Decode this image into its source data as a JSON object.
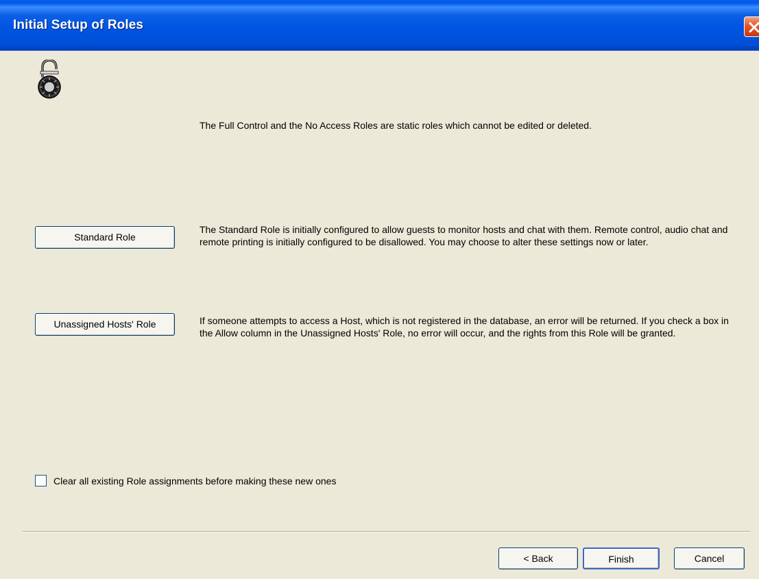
{
  "window": {
    "title": "Initial Setup of Roles",
    "close_icon": "close-icon"
  },
  "header_icon": "padlock-icon",
  "descriptions": {
    "static_roles": "The Full Control and the No Access Roles are static roles which cannot be edited or deleted.",
    "standard_role": "The Standard Role is initially configured to allow guests to monitor hosts and chat with them. Remote control, audio chat and remote printing is initially configured to be disallowed. You may choose to alter these settings now or later.",
    "unassigned_role": "If someone attempts to access a Host, which is not registered in the database, an error will be returned. If you check a box in the Allow column in the Unassigned Hosts' Role, no error will occur, and the rights from this Role will be granted."
  },
  "buttons": {
    "standard_role": "Standard Role",
    "unassigned_role": "Unassigned Hosts' Role",
    "back": "< Back",
    "finish": "Finish",
    "cancel": "Cancel"
  },
  "clear_checkbox": {
    "label": "Clear all existing Role assignments before making these new ones",
    "checked": false
  },
  "colors": {
    "titlebar": "#0054e3",
    "dialog_bg": "#ece9d8",
    "close_button": "#e4572e"
  }
}
